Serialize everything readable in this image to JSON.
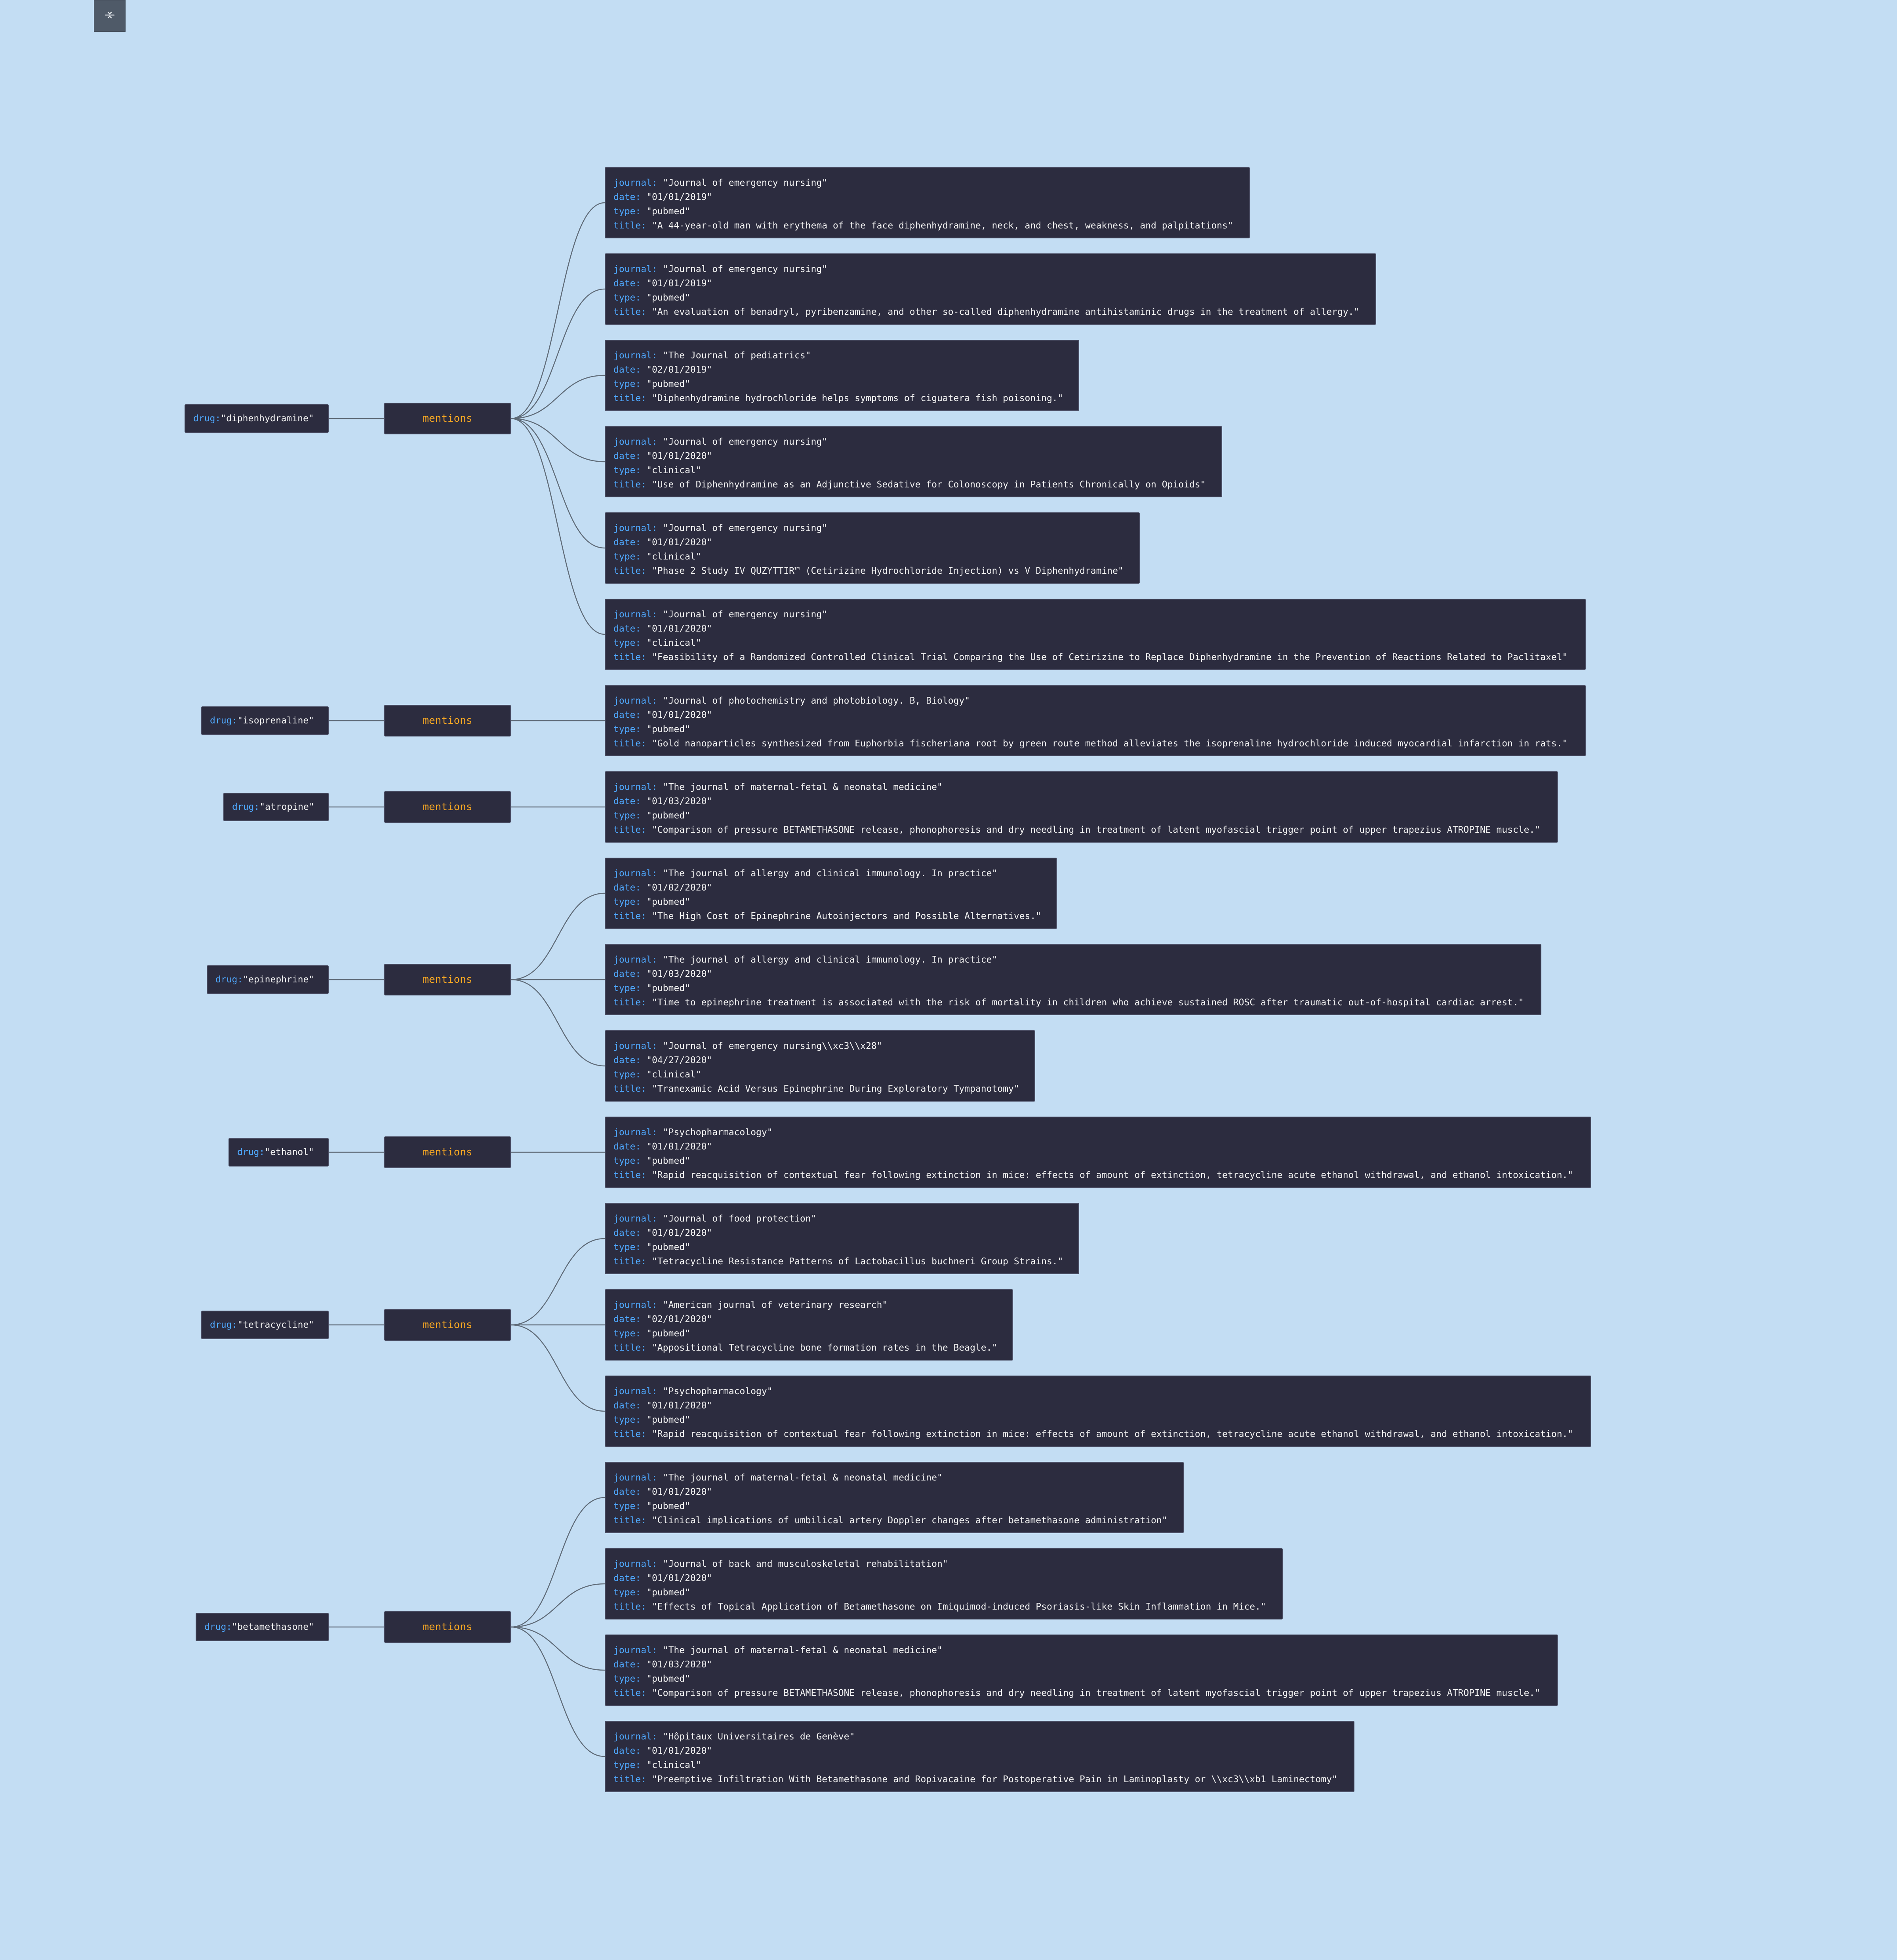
{
  "toolbar": {
    "icon": "collapse-expand-icon"
  },
  "colors": {
    "background": "#c3ddf3",
    "node": "#2c2c3f",
    "key": "#4fa8ff",
    "relation": "#f5a623",
    "link": "#5f6b78"
  },
  "labels": {
    "drug_key": "drug:",
    "relation": "mentions",
    "journal_key": "journal:",
    "date_key": "date:",
    "type_key": "type:",
    "title_key": "title:"
  },
  "drugs": [
    {
      "name": "\"diphenhydramine\"",
      "mentions": [
        {
          "journal": "\"Journal of emergency nursing\"",
          "date": "\"01/01/2019\"",
          "type": "\"pubmed\"",
          "title": "\"A 44-year-old man with erythema of the face diphenhydramine, neck, and chest, weakness, and palpitations\""
        },
        {
          "journal": "\"Journal of emergency nursing\"",
          "date": "\"01/01/2019\"",
          "type": "\"pubmed\"",
          "title": "\"An evaluation of benadryl, pyribenzamine, and other so-called diphenhydramine antihistaminic drugs in the treatment of allergy.\""
        },
        {
          "journal": "\"The Journal of pediatrics\"",
          "date": "\"02/01/2019\"",
          "type": "\"pubmed\"",
          "title": "\"Diphenhydramine hydrochloride helps symptoms of ciguatera fish poisoning.\""
        },
        {
          "journal": "\"Journal of emergency nursing\"",
          "date": "\"01/01/2020\"",
          "type": "\"clinical\"",
          "title": "\"Use of Diphenhydramine as an Adjunctive Sedative for Colonoscopy in Patients Chronically on Opioids\""
        },
        {
          "journal": "\"Journal of emergency nursing\"",
          "date": "\"01/01/2020\"",
          "type": "\"clinical\"",
          "title": "\"Phase 2 Study IV QUZYTTIR™ (Cetirizine Hydrochloride Injection) vs V Diphenhydramine\""
        },
        {
          "journal": "\"Journal of emergency nursing\"",
          "date": "\"01/01/2020\"",
          "type": "\"clinical\"",
          "title": "\"Feasibility of a Randomized Controlled Clinical Trial Comparing the Use of Cetirizine to Replace Diphenhydramine in the Prevention of Reactions Related to Paclitaxel\""
        }
      ]
    },
    {
      "name": "\"isoprenaline\"",
      "mentions": [
        {
          "journal": "\"Journal of photochemistry and photobiology. B, Biology\"",
          "date": "\"01/01/2020\"",
          "type": "\"pubmed\"",
          "title": "\"Gold nanoparticles synthesized from Euphorbia fischeriana root by green route method alleviates the isoprenaline hydrochloride induced myocardial infarction in rats.\""
        }
      ]
    },
    {
      "name": "\"atropine\"",
      "mentions": [
        {
          "journal": "\"The journal of maternal-fetal & neonatal medicine\"",
          "date": "\"01/03/2020\"",
          "type": "\"pubmed\"",
          "title": "\"Comparison of pressure BETAMETHASONE release, phonophoresis and dry needling in treatment of latent myofascial trigger point of upper trapezius ATROPINE muscle.\""
        }
      ]
    },
    {
      "name": "\"epinephrine\"",
      "mentions": [
        {
          "journal": "\"The journal of allergy and clinical immunology. In practice\"",
          "date": "\"01/02/2020\"",
          "type": "\"pubmed\"",
          "title": "\"The High Cost of Epinephrine Autoinjectors and Possible Alternatives.\""
        },
        {
          "journal": "\"The journal of allergy and clinical immunology. In practice\"",
          "date": "\"01/03/2020\"",
          "type": "\"pubmed\"",
          "title": "\"Time to epinephrine treatment is associated with the risk of mortality in children who achieve sustained ROSC after traumatic out-of-hospital cardiac arrest.\""
        },
        {
          "journal": "\"Journal of emergency nursing\\\\xc3\\\\x28\"",
          "date": "\"04/27/2020\"",
          "type": "\"clinical\"",
          "title": "\"Tranexamic Acid Versus Epinephrine During Exploratory Tympanotomy\""
        }
      ]
    },
    {
      "name": "\"ethanol\"",
      "mentions": [
        {
          "journal": "\"Psychopharmacology\"",
          "date": "\"01/01/2020\"",
          "type": "\"pubmed\"",
          "title": "\"Rapid reacquisition of contextual fear following extinction in mice: effects of amount of extinction, tetracycline acute ethanol withdrawal, and ethanol intoxication.\""
        }
      ]
    },
    {
      "name": "\"tetracycline\"",
      "mentions": [
        {
          "journal": "\"Journal of food protection\"",
          "date": "\"01/01/2020\"",
          "type": "\"pubmed\"",
          "title": "\"Tetracycline Resistance Patterns of Lactobacillus buchneri Group Strains.\""
        },
        {
          "journal": "\"American journal of veterinary research\"",
          "date": "\"02/01/2020\"",
          "type": "\"pubmed\"",
          "title": "\"Appositional Tetracycline bone formation rates in the Beagle.\""
        },
        {
          "journal": "\"Psychopharmacology\"",
          "date": "\"01/01/2020\"",
          "type": "\"pubmed\"",
          "title": "\"Rapid reacquisition of contextual fear following extinction in mice: effects of amount of extinction, tetracycline acute ethanol withdrawal, and ethanol intoxication.\""
        }
      ]
    },
    {
      "name": "\"betamethasone\"",
      "mentions": [
        {
          "journal": "\"The journal of maternal-fetal & neonatal medicine\"",
          "date": "\"01/01/2020\"",
          "type": "\"pubmed\"",
          "title": "\"Clinical implications of umbilical artery Doppler changes after betamethasone administration\""
        },
        {
          "journal": "\"Journal of back and musculoskeletal rehabilitation\"",
          "date": "\"01/01/2020\"",
          "type": "\"pubmed\"",
          "title": "\"Effects of Topical Application of Betamethasone on Imiquimod-induced Psoriasis-like Skin Inflammation in Mice.\""
        },
        {
          "journal": "\"The journal of maternal-fetal & neonatal medicine\"",
          "date": "\"01/03/2020\"",
          "type": "\"pubmed\"",
          "title": "\"Comparison of pressure BETAMETHASONE release, phonophoresis and dry needling in treatment of latent myofascial trigger point of upper trapezius ATROPINE muscle.\""
        },
        {
          "journal": "\"Hôpitaux Universitaires de Genève\"",
          "date": "\"01/01/2020\"",
          "type": "\"clinical\"",
          "title": "\"Preemptive Infiltration With Betamethasone and Ropivacaine for Postoperative Pain in Laminoplasty or \\\\xc3\\\\xb1 Laminectomy\""
        }
      ]
    }
  ]
}
